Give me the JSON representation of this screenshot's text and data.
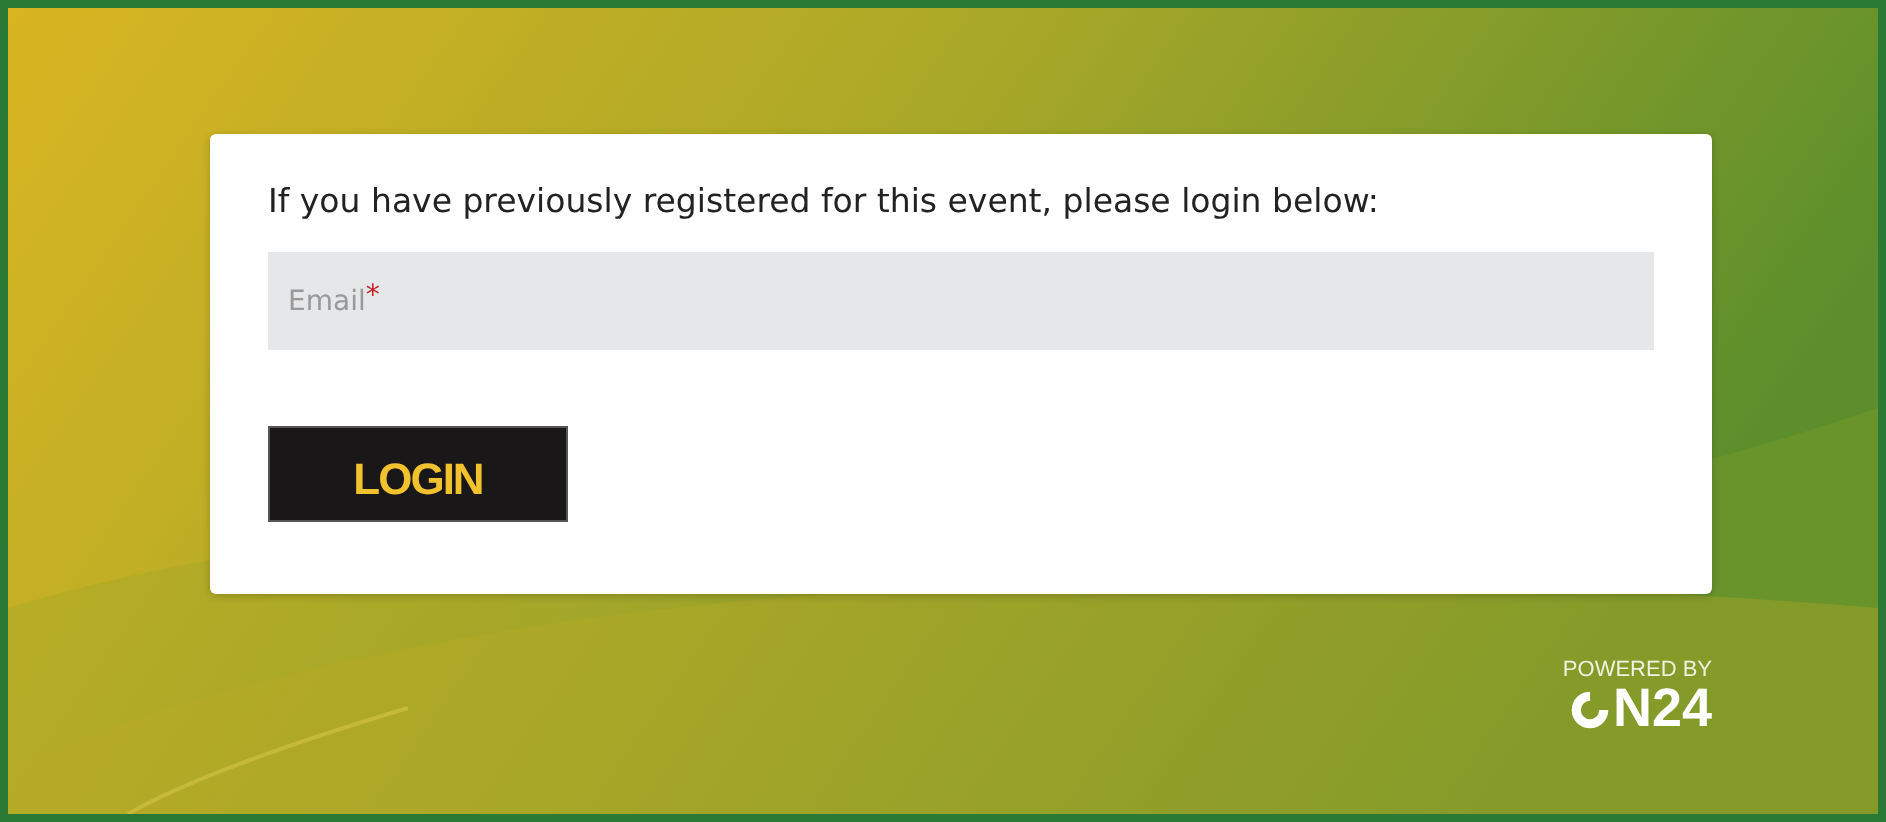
{
  "login_card": {
    "prompt": "If you have previously registered for this event, please login below:",
    "email_field": {
      "placeholder": "Email",
      "required_mark": "*"
    },
    "login_button": "LOGIN"
  },
  "footer": {
    "powered_by": "POWERED BY",
    "logo_text": "N24"
  }
}
